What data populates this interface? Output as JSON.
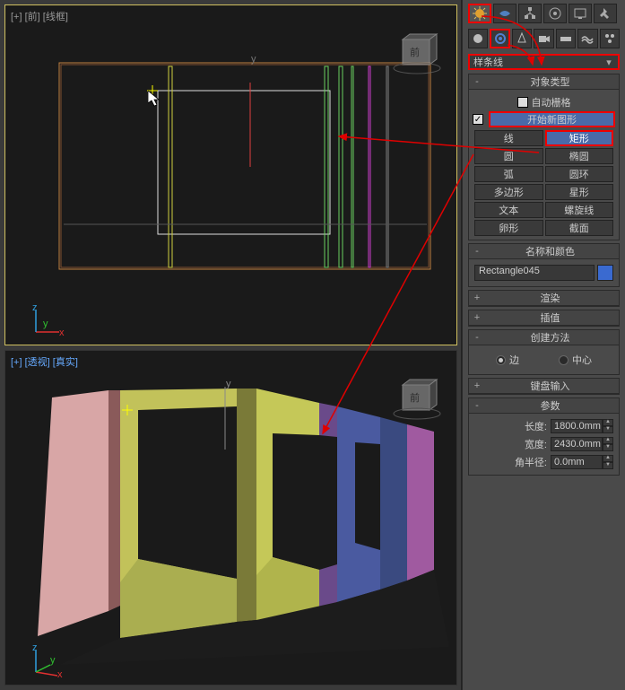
{
  "viewports": {
    "top": {
      "label": "[+] [前] [线框]",
      "cube_face": "前"
    },
    "bot": {
      "label": "[+] [透视] [真实]",
      "cube_face": "前"
    }
  },
  "dropdown": {
    "selected": "样条线"
  },
  "rollouts": {
    "obj_type": {
      "title": "对象类型",
      "autogrid": "自动栅格",
      "start_new": "开始新图形"
    },
    "name_color": {
      "title": "名称和颜色"
    },
    "render": {
      "title": "渲染"
    },
    "interp": {
      "title": "插值"
    },
    "create_method": {
      "title": "创建方法",
      "opt_edge": "边",
      "opt_center": "中心"
    },
    "kbd": {
      "title": "键盘输入"
    },
    "params": {
      "title": "参数",
      "length": "长度:",
      "width": "宽度:",
      "corner_r": "角半径:"
    }
  },
  "buttons": {
    "line": "线",
    "rect": "矩形",
    "circle": "圆",
    "ellipse": "椭圆",
    "arc": "弧",
    "donut": "圆环",
    "ngon": "多边形",
    "star": "星形",
    "text": "文本",
    "helix": "螺旋线",
    "egg": "卵形",
    "section": "截面"
  },
  "name_field": "Rectangle045",
  "params": {
    "length": "1800.0mm",
    "width": "2430.0mm",
    "corner_r": "0.0mm"
  },
  "color_swatch": "#3a6ad0"
}
